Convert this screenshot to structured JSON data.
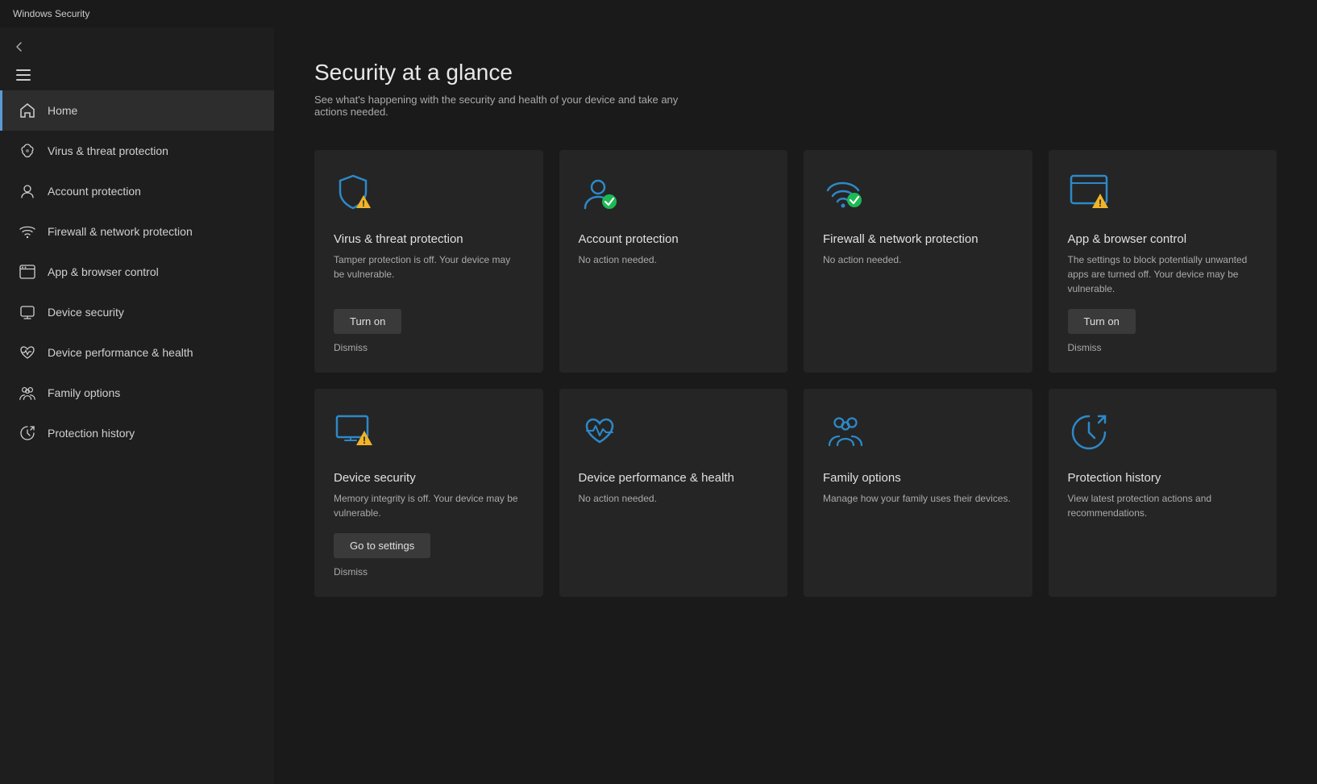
{
  "app": {
    "title": "Windows Security"
  },
  "sidebar": {
    "back_label": "←",
    "menu_label": "☰",
    "items": [
      {
        "id": "home",
        "label": "Home",
        "active": true,
        "icon": "home-icon"
      },
      {
        "id": "virus",
        "label": "Virus & threat protection",
        "active": false,
        "icon": "virus-icon"
      },
      {
        "id": "account",
        "label": "Account protection",
        "active": false,
        "icon": "account-icon"
      },
      {
        "id": "firewall",
        "label": "Firewall & network protection",
        "active": false,
        "icon": "wifi-icon"
      },
      {
        "id": "browser",
        "label": "App & browser control",
        "active": false,
        "icon": "browser-icon"
      },
      {
        "id": "device-security",
        "label": "Device security",
        "active": false,
        "icon": "device-security-icon"
      },
      {
        "id": "device-perf",
        "label": "Device performance & health",
        "active": false,
        "icon": "heart-icon"
      },
      {
        "id": "family",
        "label": "Family options",
        "active": false,
        "icon": "family-icon"
      },
      {
        "id": "history",
        "label": "Protection history",
        "active": false,
        "icon": "history-icon"
      }
    ]
  },
  "main": {
    "title": "Security at a glance",
    "subtitle": "See what's happening with the security and health of your device and take any actions needed.",
    "cards_row1": [
      {
        "id": "virus-card",
        "title": "Virus & threat protection",
        "desc": "Tamper protection is off. Your device may be vulnerable.",
        "status": "warning",
        "button": "Turn on",
        "dismiss": "Dismiss"
      },
      {
        "id": "account-card",
        "title": "Account protection",
        "desc": "No action needed.",
        "status": "ok",
        "button": null,
        "dismiss": null
      },
      {
        "id": "firewall-card",
        "title": "Firewall & network protection",
        "desc": "No action needed.",
        "status": "ok",
        "button": null,
        "dismiss": null
      },
      {
        "id": "browser-card",
        "title": "App & browser control",
        "desc": "The settings to block potentially unwanted apps are turned off. Your device may be vulnerable.",
        "status": "warning",
        "button": "Turn on",
        "dismiss": "Dismiss"
      }
    ],
    "cards_row2": [
      {
        "id": "device-security-card",
        "title": "Device security",
        "desc": "Memory integrity is off. Your device may be vulnerable.",
        "status": "warning",
        "button": "Go to settings",
        "dismiss": "Dismiss"
      },
      {
        "id": "device-perf-card",
        "title": "Device performance & health",
        "desc": "No action needed.",
        "status": "ok",
        "button": null,
        "dismiss": null
      },
      {
        "id": "family-card",
        "title": "Family options",
        "desc": "Manage how your family uses their devices.",
        "status": "info",
        "button": null,
        "dismiss": null
      },
      {
        "id": "history-card",
        "title": "Protection history",
        "desc": "View latest protection actions and recommendations.",
        "status": "info",
        "button": null,
        "dismiss": null
      }
    ]
  },
  "colors": {
    "blue": "#2d89c8",
    "blue_light": "#4aa8e8",
    "green": "#1db954",
    "yellow": "#f0b429",
    "warning_bg": "#c8a000"
  }
}
